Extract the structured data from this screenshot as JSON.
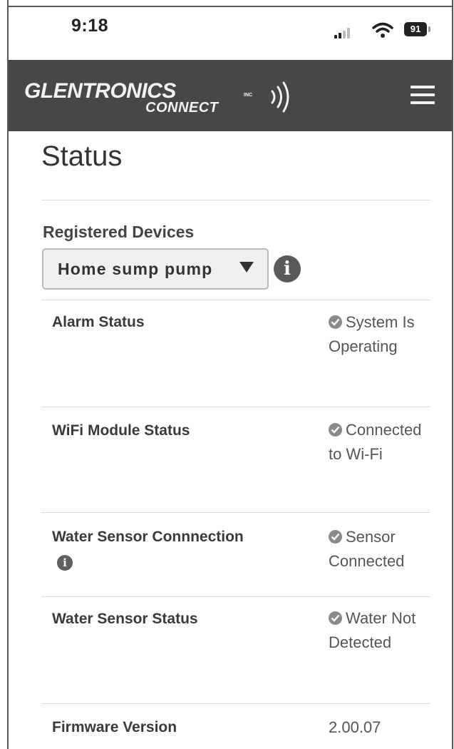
{
  "status_bar": {
    "time": "9:18",
    "battery": "91",
    "icons": [
      "signal-icon",
      "wifi-icon",
      "battery-icon"
    ]
  },
  "header": {
    "logo_main": "GLENTRONICS",
    "logo_inc": "INC",
    "logo_sub": "CONNECT",
    "menu_icon": "hamburger-menu-icon",
    "background": "#474747"
  },
  "page": {
    "title": "Status"
  },
  "devices": {
    "label": "Registered Devices",
    "selected": "Home sump pump",
    "info_icon": "info-icon"
  },
  "status_rows": [
    {
      "label": "Alarm Status",
      "value_line1": "System Is",
      "value_line2": "Operating",
      "icon": "check-circle-icon"
    },
    {
      "label": "WiFi Module Status",
      "value_line1": "Connected",
      "value_line2": "to Wi-Fi",
      "icon": "check-circle-icon"
    },
    {
      "label": "Water Sensor Connnection",
      "value_line1": "Sensor",
      "value_line2": "Connected",
      "icon": "check-circle-icon"
    },
    {
      "label": "Water Sensor Status",
      "value_line1": "Water Not",
      "value_line2": "Detected",
      "icon": "check-circle-icon"
    },
    {
      "label": "Firmware Version",
      "value_line1": "2.00.07"
    }
  ]
}
